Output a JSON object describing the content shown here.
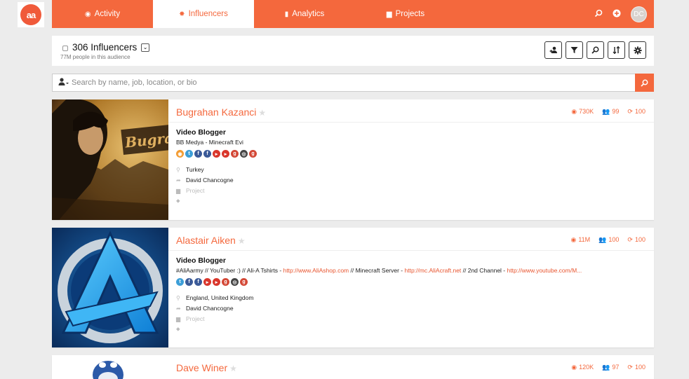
{
  "logo": {
    "text": "aa"
  },
  "nav": {
    "tabs": [
      {
        "label": "Activity",
        "icon": "rss-icon",
        "glyph": "◉"
      },
      {
        "label": "Influencers",
        "icon": "paw-icon",
        "glyph": "✸"
      },
      {
        "label": "Analytics",
        "icon": "bar-chart-icon",
        "glyph": "▮"
      },
      {
        "label": "Projects",
        "icon": "folder-icon",
        "glyph": "▆"
      }
    ],
    "avatar": "DC"
  },
  "header": {
    "title": "306 Influencers",
    "subtitle": "77M people in this audience"
  },
  "search": {
    "placeholder": "Search by name, job, location, or bio"
  },
  "influencers": [
    {
      "name": "Bugrahan Kazanci",
      "views": "730K",
      "audience": "99",
      "score": "100",
      "job": "Video Blogger",
      "bio_prefix": "BB Medya - Minecraft Evi",
      "bio_link1": "",
      "bio_mid1": "",
      "bio_link2": "",
      "bio_mid2": "",
      "bio_link3": "",
      "location": "Turkey",
      "owner": "David Chancogne",
      "project": "Project",
      "socials": [
        {
          "icon": "rss-icon",
          "color": "#f39c32",
          "g": "◉"
        },
        {
          "icon": "twitter-icon",
          "color": "#3d9fd8",
          "g": "t"
        },
        {
          "icon": "facebook-icon",
          "color": "#3b5a98",
          "g": "f"
        },
        {
          "icon": "facebook-icon",
          "color": "#3b5a98",
          "g": "f"
        },
        {
          "icon": "youtube-icon",
          "color": "#d9362b",
          "g": "▸"
        },
        {
          "icon": "youtube-icon",
          "color": "#d9362b",
          "g": "▸"
        },
        {
          "icon": "google-plus-icon",
          "color": "#d34836",
          "g": "g"
        },
        {
          "icon": "instagram-icon",
          "color": "#444",
          "g": "◎"
        },
        {
          "icon": "google-plus-icon",
          "color": "#d34836",
          "g": "g"
        }
      ]
    },
    {
      "name": "Alastair Aiken",
      "views": "11M",
      "audience": "100",
      "score": "100",
      "job": "Video Blogger",
      "bio_prefix": "#AliAarmy // YouTuber :) // Ali-A Tshirts - ",
      "bio_link1": "http://www.AliAshop.com",
      "bio_mid1": " // Minecraft Server - ",
      "bio_link2": "http://mc.AliAcraft.net",
      "bio_mid2": " // 2nd Channel - ",
      "bio_link3": "http://www.youtube.com/M...",
      "location": "England, United Kingdom",
      "owner": "David Chancogne",
      "project": "Project",
      "socials": [
        {
          "icon": "twitter-icon",
          "color": "#3d9fd8",
          "g": "t"
        },
        {
          "icon": "facebook-icon",
          "color": "#3b5a98",
          "g": "f"
        },
        {
          "icon": "facebook-icon",
          "color": "#3b5a98",
          "g": "f"
        },
        {
          "icon": "youtube-icon",
          "color": "#d9362b",
          "g": "▸"
        },
        {
          "icon": "youtube-icon",
          "color": "#d9362b",
          "g": "▸"
        },
        {
          "icon": "google-plus-icon",
          "color": "#d34836",
          "g": "g"
        },
        {
          "icon": "instagram-icon",
          "color": "#444",
          "g": "◎"
        },
        {
          "icon": "google-plus-icon",
          "color": "#d34836",
          "g": "g"
        }
      ]
    },
    {
      "name": "Dave Winer",
      "views": "120K",
      "audience": "97",
      "score": "100"
    }
  ],
  "colors": {
    "accent": "#f4683d"
  }
}
